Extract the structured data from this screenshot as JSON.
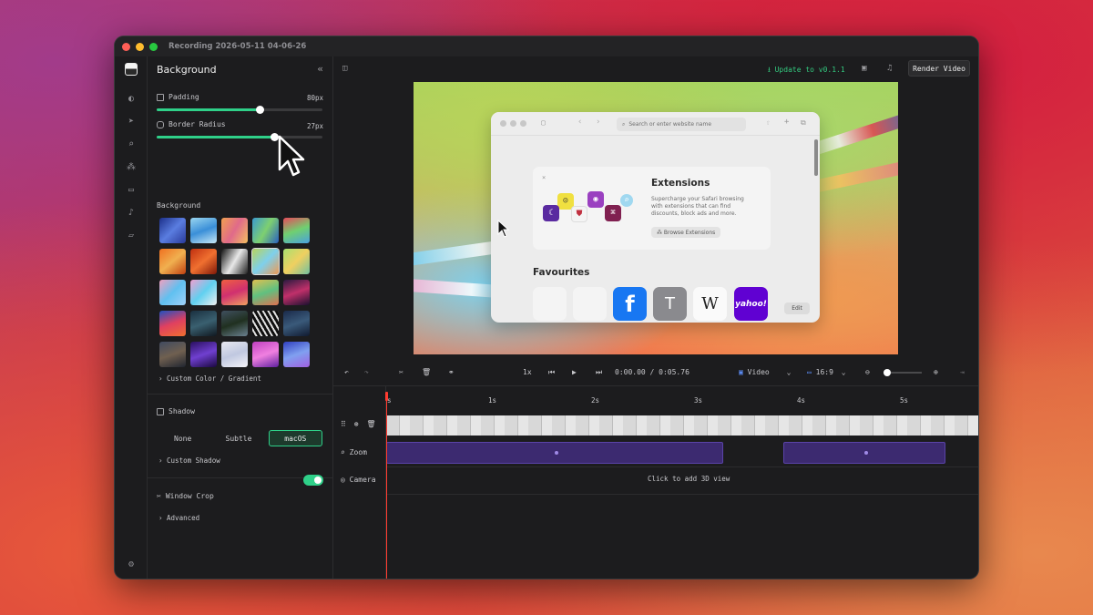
{
  "window": {
    "title": "Recording 2026-05-11 04-06-26"
  },
  "rail": {
    "icons": [
      "palette-icon",
      "cursor-icon",
      "magnifier-icon",
      "shapes-icon",
      "laptop-icon",
      "microphone-icon",
      "folder-icon",
      "gear-icon"
    ]
  },
  "panel": {
    "title": "Background",
    "collapse_glyph": "«",
    "padding": {
      "label": "Padding",
      "value": "80px",
      "level": 0.62
    },
    "border_radius": {
      "label": "Border Radius",
      "value": "27px",
      "level": 0.71
    },
    "background_label": "Background",
    "custom_color_link": "› Custom Color / Gradient",
    "shadow": {
      "label": "Shadow",
      "options": [
        "None",
        "Subtle",
        "macOS"
      ],
      "selected": "macOS"
    },
    "custom_shadow_link": "› Custom Shadow",
    "window_crop": {
      "label": "Window Crop",
      "enabled": true
    },
    "advanced_link": "› Advanced"
  },
  "toolbar": {
    "update_label": "⭳ Update to v0.1.1",
    "render_label": "Render Video"
  },
  "safari": {
    "search_placeholder": "Search or enter website name",
    "extensions_title": "Extensions",
    "extensions_desc": "Supercharge your Safari browsing with extensions that can find discounts, block ads and more.",
    "browse_label": "⁂ Browse Extensions",
    "favourites_title": "Favourites",
    "favourites": [
      {
        "name": "apple-1",
        "glyph": ""
      },
      {
        "name": "apple-2",
        "glyph": ""
      },
      {
        "name": "facebook",
        "glyph": "f"
      },
      {
        "name": "t",
        "glyph": "T"
      },
      {
        "name": "wikipedia",
        "glyph": "W"
      },
      {
        "name": "yahoo",
        "glyph": "yahoo!"
      }
    ],
    "edit_label": "Edit"
  },
  "controls": {
    "speed": "1x",
    "timecode": "0:00.00 / 0:05.76",
    "source": "Video",
    "aspect": "16:9"
  },
  "timeline": {
    "ticks": [
      "s",
      "1s",
      "2s",
      "3s",
      "4s",
      "5s"
    ],
    "zoom_label": "Zoom",
    "camera_label": "Camera",
    "camera_hint": "Click to add 3D view"
  },
  "colors": {
    "accent": "#2fd089",
    "zoom_segment": "#3c2a70",
    "playhead": "#ff3b30"
  }
}
